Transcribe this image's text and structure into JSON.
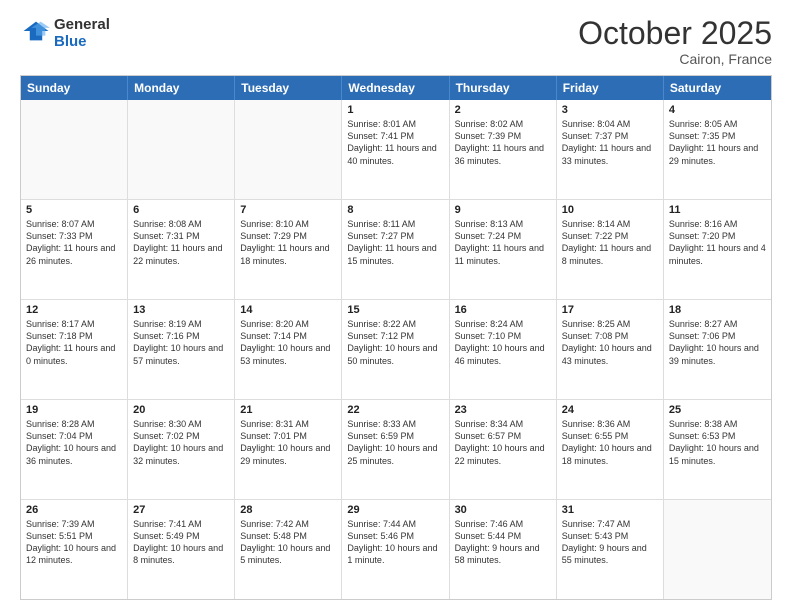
{
  "header": {
    "logo_line1": "General",
    "logo_line2": "Blue",
    "month": "October 2025",
    "location": "Cairon, France"
  },
  "weekdays": [
    "Sunday",
    "Monday",
    "Tuesday",
    "Wednesday",
    "Thursday",
    "Friday",
    "Saturday"
  ],
  "rows": [
    [
      {
        "day": "",
        "sunrise": "",
        "sunset": "",
        "daylight": "",
        "empty": true
      },
      {
        "day": "",
        "sunrise": "",
        "sunset": "",
        "daylight": "",
        "empty": true
      },
      {
        "day": "",
        "sunrise": "",
        "sunset": "",
        "daylight": "",
        "empty": true
      },
      {
        "day": "1",
        "sunrise": "Sunrise: 8:01 AM",
        "sunset": "Sunset: 7:41 PM",
        "daylight": "Daylight: 11 hours and 40 minutes."
      },
      {
        "day": "2",
        "sunrise": "Sunrise: 8:02 AM",
        "sunset": "Sunset: 7:39 PM",
        "daylight": "Daylight: 11 hours and 36 minutes."
      },
      {
        "day": "3",
        "sunrise": "Sunrise: 8:04 AM",
        "sunset": "Sunset: 7:37 PM",
        "daylight": "Daylight: 11 hours and 33 minutes."
      },
      {
        "day": "4",
        "sunrise": "Sunrise: 8:05 AM",
        "sunset": "Sunset: 7:35 PM",
        "daylight": "Daylight: 11 hours and 29 minutes."
      }
    ],
    [
      {
        "day": "5",
        "sunrise": "Sunrise: 8:07 AM",
        "sunset": "Sunset: 7:33 PM",
        "daylight": "Daylight: 11 hours and 26 minutes."
      },
      {
        "day": "6",
        "sunrise": "Sunrise: 8:08 AM",
        "sunset": "Sunset: 7:31 PM",
        "daylight": "Daylight: 11 hours and 22 minutes."
      },
      {
        "day": "7",
        "sunrise": "Sunrise: 8:10 AM",
        "sunset": "Sunset: 7:29 PM",
        "daylight": "Daylight: 11 hours and 18 minutes."
      },
      {
        "day": "8",
        "sunrise": "Sunrise: 8:11 AM",
        "sunset": "Sunset: 7:27 PM",
        "daylight": "Daylight: 11 hours and 15 minutes."
      },
      {
        "day": "9",
        "sunrise": "Sunrise: 8:13 AM",
        "sunset": "Sunset: 7:24 PM",
        "daylight": "Daylight: 11 hours and 11 minutes."
      },
      {
        "day": "10",
        "sunrise": "Sunrise: 8:14 AM",
        "sunset": "Sunset: 7:22 PM",
        "daylight": "Daylight: 11 hours and 8 minutes."
      },
      {
        "day": "11",
        "sunrise": "Sunrise: 8:16 AM",
        "sunset": "Sunset: 7:20 PM",
        "daylight": "Daylight: 11 hours and 4 minutes."
      }
    ],
    [
      {
        "day": "12",
        "sunrise": "Sunrise: 8:17 AM",
        "sunset": "Sunset: 7:18 PM",
        "daylight": "Daylight: 11 hours and 0 minutes."
      },
      {
        "day": "13",
        "sunrise": "Sunrise: 8:19 AM",
        "sunset": "Sunset: 7:16 PM",
        "daylight": "Daylight: 10 hours and 57 minutes."
      },
      {
        "day": "14",
        "sunrise": "Sunrise: 8:20 AM",
        "sunset": "Sunset: 7:14 PM",
        "daylight": "Daylight: 10 hours and 53 minutes."
      },
      {
        "day": "15",
        "sunrise": "Sunrise: 8:22 AM",
        "sunset": "Sunset: 7:12 PM",
        "daylight": "Daylight: 10 hours and 50 minutes."
      },
      {
        "day": "16",
        "sunrise": "Sunrise: 8:24 AM",
        "sunset": "Sunset: 7:10 PM",
        "daylight": "Daylight: 10 hours and 46 minutes."
      },
      {
        "day": "17",
        "sunrise": "Sunrise: 8:25 AM",
        "sunset": "Sunset: 7:08 PM",
        "daylight": "Daylight: 10 hours and 43 minutes."
      },
      {
        "day": "18",
        "sunrise": "Sunrise: 8:27 AM",
        "sunset": "Sunset: 7:06 PM",
        "daylight": "Daylight: 10 hours and 39 minutes."
      }
    ],
    [
      {
        "day": "19",
        "sunrise": "Sunrise: 8:28 AM",
        "sunset": "Sunset: 7:04 PM",
        "daylight": "Daylight: 10 hours and 36 minutes."
      },
      {
        "day": "20",
        "sunrise": "Sunrise: 8:30 AM",
        "sunset": "Sunset: 7:02 PM",
        "daylight": "Daylight: 10 hours and 32 minutes."
      },
      {
        "day": "21",
        "sunrise": "Sunrise: 8:31 AM",
        "sunset": "Sunset: 7:01 PM",
        "daylight": "Daylight: 10 hours and 29 minutes."
      },
      {
        "day": "22",
        "sunrise": "Sunrise: 8:33 AM",
        "sunset": "Sunset: 6:59 PM",
        "daylight": "Daylight: 10 hours and 25 minutes."
      },
      {
        "day": "23",
        "sunrise": "Sunrise: 8:34 AM",
        "sunset": "Sunset: 6:57 PM",
        "daylight": "Daylight: 10 hours and 22 minutes."
      },
      {
        "day": "24",
        "sunrise": "Sunrise: 8:36 AM",
        "sunset": "Sunset: 6:55 PM",
        "daylight": "Daylight: 10 hours and 18 minutes."
      },
      {
        "day": "25",
        "sunrise": "Sunrise: 8:38 AM",
        "sunset": "Sunset: 6:53 PM",
        "daylight": "Daylight: 10 hours and 15 minutes."
      }
    ],
    [
      {
        "day": "26",
        "sunrise": "Sunrise: 7:39 AM",
        "sunset": "Sunset: 5:51 PM",
        "daylight": "Daylight: 10 hours and 12 minutes."
      },
      {
        "day": "27",
        "sunrise": "Sunrise: 7:41 AM",
        "sunset": "Sunset: 5:49 PM",
        "daylight": "Daylight: 10 hours and 8 minutes."
      },
      {
        "day": "28",
        "sunrise": "Sunrise: 7:42 AM",
        "sunset": "Sunset: 5:48 PM",
        "daylight": "Daylight: 10 hours and 5 minutes."
      },
      {
        "day": "29",
        "sunrise": "Sunrise: 7:44 AM",
        "sunset": "Sunset: 5:46 PM",
        "daylight": "Daylight: 10 hours and 1 minute."
      },
      {
        "day": "30",
        "sunrise": "Sunrise: 7:46 AM",
        "sunset": "Sunset: 5:44 PM",
        "daylight": "Daylight: 9 hours and 58 minutes."
      },
      {
        "day": "31",
        "sunrise": "Sunrise: 7:47 AM",
        "sunset": "Sunset: 5:43 PM",
        "daylight": "Daylight: 9 hours and 55 minutes."
      },
      {
        "day": "",
        "sunrise": "",
        "sunset": "",
        "daylight": "",
        "empty": true
      }
    ]
  ]
}
